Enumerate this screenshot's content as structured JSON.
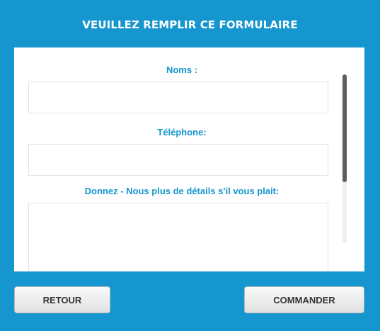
{
  "header": {
    "title": "VEUILLEZ REMPLIR CE FORMULAIRE"
  },
  "form": {
    "fields": [
      {
        "label": "Noms :",
        "value": ""
      },
      {
        "label": "Téléphone:",
        "value": ""
      },
      {
        "label": "Donnez - Nous plus de détails s'il vous plait:",
        "value": ""
      }
    ]
  },
  "buttons": {
    "back_label": "RETOUR",
    "order_label": "COMMANDER"
  },
  "colors": {
    "background": "#1596cf",
    "accent_text": "#1596cf",
    "panel": "#ffffff"
  }
}
